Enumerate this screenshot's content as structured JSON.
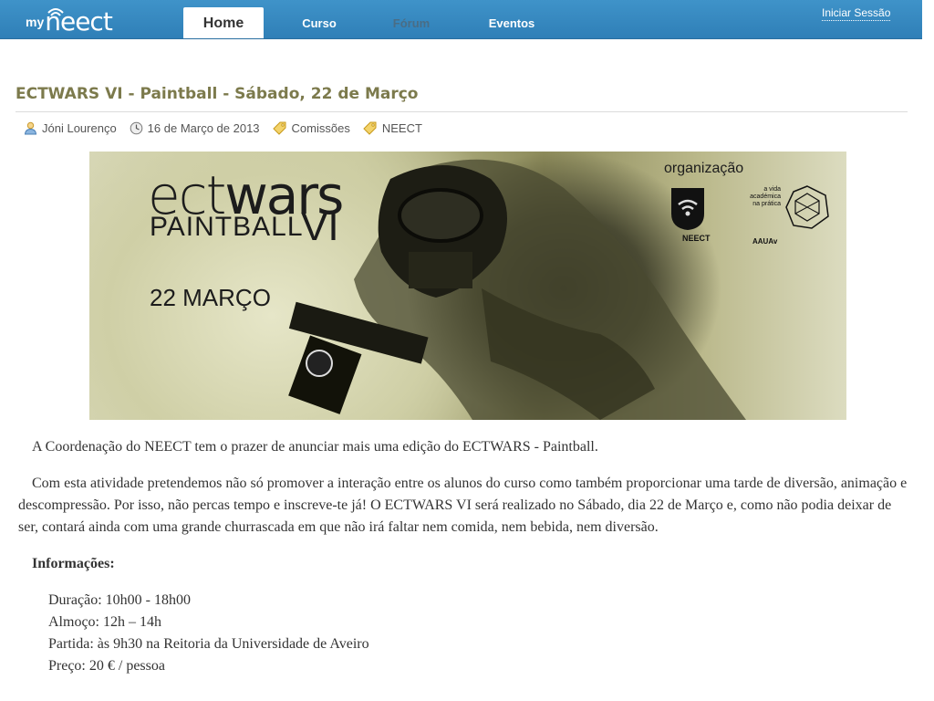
{
  "header": {
    "logo_prefix": "my",
    "logo_name": "neect",
    "nav": [
      {
        "label": "Home"
      },
      {
        "label": "Curso"
      },
      {
        "label": "Fórum"
      },
      {
        "label": "Eventos"
      }
    ],
    "login_label": "Iniciar Sessão",
    "colors": {
      "bar": "#3588c0",
      "muted_nav": "#4a6d85",
      "title": "#7c7a4c"
    }
  },
  "article": {
    "title": "ECTWARS VI - Paintball - Sábado, 22 de Março",
    "meta": {
      "author": "Jóni Lourenço",
      "author_icon": "user-icon",
      "date": "16 de Março de 2013",
      "date_icon": "clock-icon",
      "tags": [
        "Comissões",
        "NEECT"
      ],
      "tag_icon": "tag-icon"
    },
    "banner": {
      "brand_light": "ect",
      "brand_bold": "wars",
      "subtitle": "PAINTBALL",
      "roman": "VI",
      "date": "22 MARÇO",
      "org_label": "organização",
      "org1": "NEECT",
      "org2_tagline": "a vida académica na prática",
      "org2": "AAUAv"
    },
    "paragraphs": [
      "A Coordenação do NEECT tem o prazer de anunciar mais uma edição do ECTWARS - Paintball.",
      "Com esta atividade pretendemos não só promover a interação entre os alunos do curso como também proporcionar uma tarde de diversão, animação e descompressão. Por isso, não percas tempo e inscreve-te já! O ECTWARS VI será realizado no Sábado, dia 22 de Março e, como não podia deixar de ser, contará ainda com uma grande churrascada em que não irá faltar nem comida, nem bebida, nem diversão."
    ],
    "info_title": "Informações:",
    "info": [
      "Duração: 10h00 - 18h00",
      "Almoço: 12h – 14h",
      "Partida: às 9h30 na Reitoria da Universidade de Aveiro",
      "Preço: 20 € / pessoa"
    ]
  }
}
